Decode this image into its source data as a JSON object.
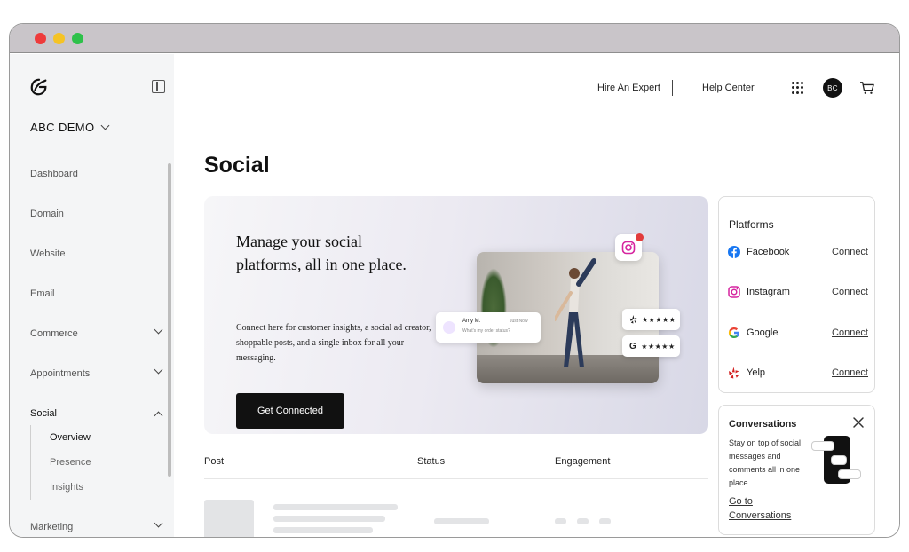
{
  "sidebar": {
    "account": "ABC DEMO",
    "items": [
      {
        "label": "Dashboard"
      },
      {
        "label": "Domain"
      },
      {
        "label": "Website"
      },
      {
        "label": "Email"
      },
      {
        "label": "Commerce"
      },
      {
        "label": "Appointments"
      },
      {
        "label": "Social"
      },
      {
        "label": "Marketing"
      }
    ],
    "social_sub": [
      {
        "label": "Overview"
      },
      {
        "label": "Presence"
      },
      {
        "label": "Insights"
      }
    ]
  },
  "header": {
    "hire": "Hire An Expert",
    "help": "Help Center",
    "avatar": "BC"
  },
  "page": {
    "title": "Social"
  },
  "hero": {
    "title": "Manage your social platforms, all in one place.",
    "description": "Connect here for customer insights, a social ad creator, shoppable posts, and a single inbox for all your messaging.",
    "button": "Get Connected",
    "msg_name": "Amy M.",
    "msg_time": "Just Now",
    "msg_text": "What's my order status?",
    "yelp_stars": "★★★★★",
    "google_stars": "★★★★★",
    "google_letter": "G"
  },
  "table": {
    "columns": [
      "Post",
      "Status",
      "Engagement"
    ]
  },
  "platforms": {
    "title": "Platforms",
    "items": [
      {
        "name": "Facebook",
        "action": "Connect"
      },
      {
        "name": "Instagram",
        "action": "Connect"
      },
      {
        "name": "Google",
        "action": "Connect"
      },
      {
        "name": "Yelp",
        "action": "Connect"
      }
    ]
  },
  "conversations": {
    "title": "Conversations",
    "description": "Stay on top of social messages and comments all in one place.",
    "link": "Go to Conversations"
  },
  "colors": {
    "accent": "#111111",
    "facebook": "#1877f2",
    "instagram": "#d6249f",
    "yelp": "#d32323",
    "notification": "#e23b3b"
  }
}
